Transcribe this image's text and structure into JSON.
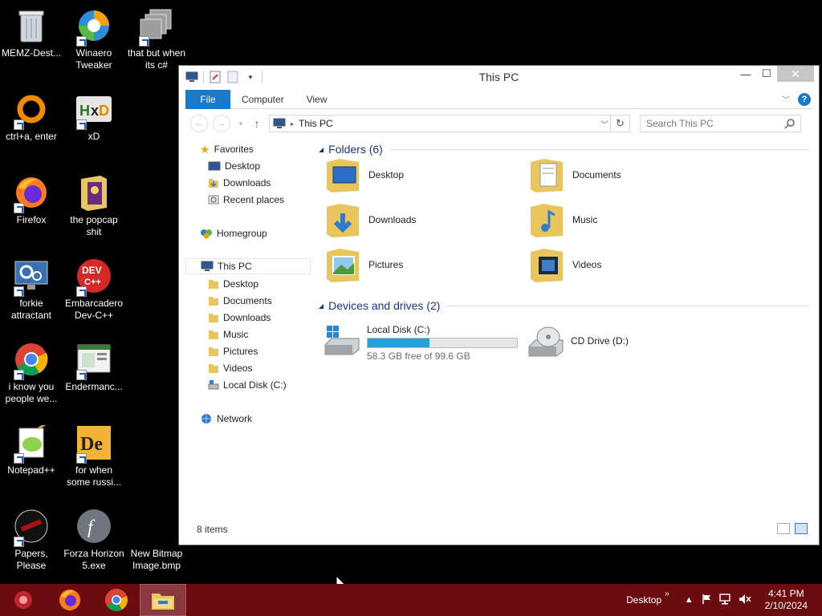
{
  "desktop": {
    "icons": [
      {
        "label": "MEMZ-Dest..."
      },
      {
        "label": "Winaero Tweaker"
      },
      {
        "label": "that but when its c#"
      },
      {
        "label": "ctrl+a, enter"
      },
      {
        "label": "xD"
      },
      {
        "label": "Firefox"
      },
      {
        "label": "the popcap shit"
      },
      {
        "label": "forkie attractant"
      },
      {
        "label": "Embarcadero Dev-C++"
      },
      {
        "label": "i know you people we..."
      },
      {
        "label": "Endermanc..."
      },
      {
        "label": "Notepad++"
      },
      {
        "label": "for when some russi..."
      },
      {
        "label": "Papers, Please"
      },
      {
        "label": "Forza Horizon 5.exe"
      },
      {
        "label": "New Bitmap Image.bmp"
      }
    ]
  },
  "window": {
    "title": "This PC",
    "minimize": "—",
    "maximize": "☐",
    "close": "✕",
    "ribbon_tabs": [
      "File",
      "Computer",
      "View"
    ],
    "address": "This PC",
    "search_placeholder": "Search This PC",
    "nav": {
      "favorites": "Favorites",
      "fav_items": [
        "Desktop",
        "Downloads",
        "Recent places"
      ],
      "homegroup": "Homegroup",
      "thispc": "This PC",
      "pc_items": [
        "Desktop",
        "Documents",
        "Downloads",
        "Music",
        "Pictures",
        "Videos",
        "Local Disk (C:)"
      ],
      "network": "Network"
    },
    "folders_header": "Folders (6)",
    "folders": [
      "Desktop",
      "Documents",
      "Downloads",
      "Music",
      "Pictures",
      "Videos"
    ],
    "devices_header": "Devices and drives (2)",
    "drives": [
      {
        "name": "Local Disk (C:)",
        "free": "58.3 GB free of 99.6 GB",
        "used_fraction": 0.415
      },
      {
        "name": "CD Drive (D:)"
      }
    ],
    "status": "8 items"
  },
  "taskbar": {
    "toolbar_label": "Desktop",
    "chevron": "»",
    "time": "4:41 PM",
    "date": "2/10/2024"
  },
  "colors": {
    "taskbar": "#6b0c10",
    "accent": "#1979ca",
    "group_title": "#1e3287",
    "drive_bar": "#26a0da"
  }
}
